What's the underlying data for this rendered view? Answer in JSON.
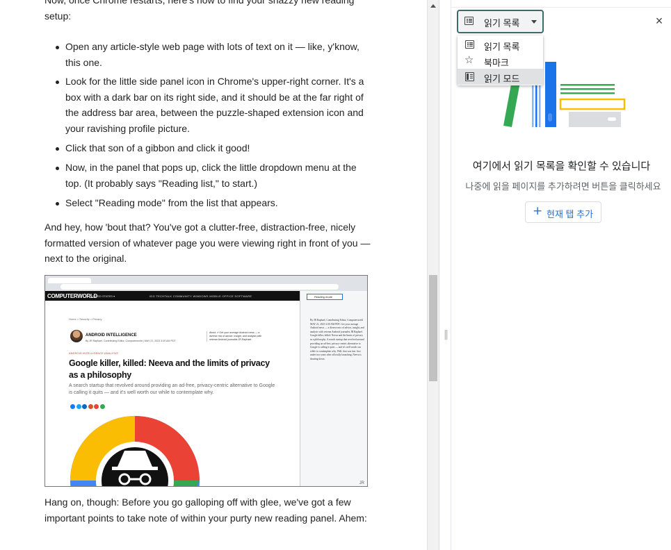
{
  "article": {
    "intro": "Now, once Chrome restarts, here's how to find your snazzy new reading setup:",
    "steps": [
      "Open any article-style web page with lots of text on it — like, y'know, this one.",
      "Look for the little side panel icon in Chrome's upper-right corner. It's a box with a dark bar on its right side, and it should be at the far right of the address bar area, between the puzzle-shaped extension icon and your ravishing profile picture.",
      "Click that son of a gibbon and click it good!",
      "Now, in the panel that pops up, click the little dropdown menu at the top. (It probably says \"Reading list,\" to start.)",
      "Select \"Reading mode\" from the list that appears."
    ],
    "para_after": "And hey, how 'bout that? You've got a clutter-free, distraction-free, nicely formatted version of whatever page you were viewing right in front of you — next to the original.",
    "para_final": "Hang on, though: Before you go galloping off with glee, we've got a few important points to take note of within your purty new reading panel. Ahem:",
    "screenshot": {
      "logo": "COMPUTERWORLD",
      "nav_edition": "UNITED STATES ▾",
      "nav_items": "IDG TECHTALK COMMUNITY     WINDOWS     MOBILE     OFFICE SOFTWARE",
      "breadcrumb": "Home  >  Security  >  Privacy",
      "kicker": "ANDROID INTELLIGENCE",
      "byline": "By JR Raphael, Contributing Editor, Computerworld  |  MAY 21, 2023 3:00 AM PDT",
      "about": "About  ↗  Get your average Android news — a diverse mix of advice, insight, and analysis with veteran Android journalist JR Raphael.",
      "category": "ANDROID INTELLIGENCE ANALYSIS",
      "headline": "Google killer, killed: Neeva and the limits of privacy as a philosophy",
      "dek": "A search startup that revolved around providing an ad-free, privacy-centric alternative to Google is calling it quits — and it's well worth our while to contemplate why.",
      "side_mode": "Reading mode",
      "side_text": "By JR Raphael, Contributing Editor, Computerworld MAY 21, 2023 3:00 AM PDT. Get your average Android news — a diverse mix of advice, insight, and analysis with veteran Android journalist JR Raphael. Google killer, killed: Neeva and the limits of privacy as a philosophy. A search startup that revolved around providing an ad-free, privacy-centric alternative to Google is calling it quits — and it's well worth our while to contemplate why. Well, that was fast. Just under two years after officially launching, Neeva is shutting down.",
      "watermark": "JR"
    }
  },
  "side_panel": {
    "mode_selected": "읽기 목록",
    "menu_items": [
      {
        "label": "읽기 목록",
        "icon": "list-icon"
      },
      {
        "label": "북마크",
        "icon": "star-icon"
      },
      {
        "label": "읽기 모드",
        "icon": "reading-mode-icon"
      }
    ],
    "close_glyph": "×",
    "empty_title": "여기에서 읽기 목록을 확인할 수 있습니다",
    "empty_subtitle": "나중에 읽을 페이지를 추가하려면 버튼을 클릭하세요",
    "add_button_label": "현재 탭 추가",
    "add_button_icon": "+",
    "accent_color": "#1a73e8"
  }
}
